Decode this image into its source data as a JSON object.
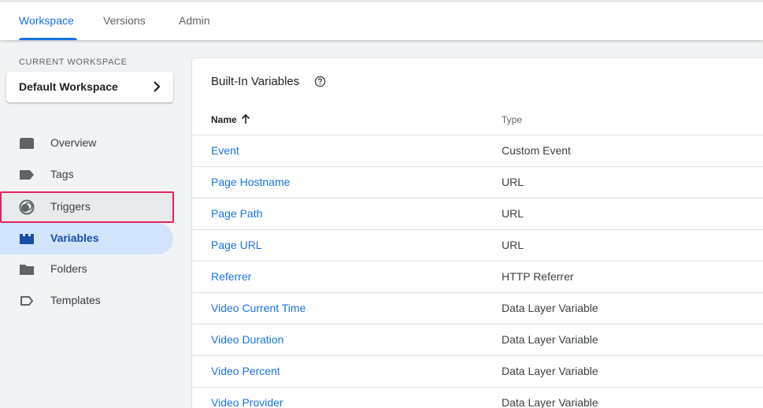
{
  "tabs": [
    {
      "label": "Workspace",
      "active": true
    },
    {
      "label": "Versions",
      "active": false
    },
    {
      "label": "Admin",
      "active": false
    }
  ],
  "sidebar": {
    "workspace_label": "CURRENT WORKSPACE",
    "workspace_name": "Default Workspace",
    "items": [
      {
        "label": "Overview",
        "icon": "overview-icon"
      },
      {
        "label": "Tags",
        "icon": "tag-icon"
      },
      {
        "label": "Triggers",
        "icon": "trigger-icon",
        "highlighted": true
      },
      {
        "label": "Variables",
        "icon": "variables-icon",
        "selected": true
      },
      {
        "label": "Folders",
        "icon": "folder-icon"
      },
      {
        "label": "Templates",
        "icon": "template-icon"
      }
    ]
  },
  "main": {
    "title": "Built-In Variables",
    "columns": {
      "name": "Name",
      "type": "Type"
    },
    "rows": [
      {
        "name": "Event",
        "type": "Custom Event"
      },
      {
        "name": "Page Hostname",
        "type": "URL"
      },
      {
        "name": "Page Path",
        "type": "URL"
      },
      {
        "name": "Page URL",
        "type": "URL"
      },
      {
        "name": "Referrer",
        "type": "HTTP Referrer"
      },
      {
        "name": "Video Current Time",
        "type": "Data Layer Variable"
      },
      {
        "name": "Video Duration",
        "type": "Data Layer Variable"
      },
      {
        "name": "Video Percent",
        "type": "Data Layer Variable"
      },
      {
        "name": "Video Provider",
        "type": "Data Layer Variable"
      }
    ]
  },
  "colors": {
    "accent": "#1a73e8",
    "selected_bg": "#d2e3fc",
    "highlight_border": "#e0245e"
  }
}
